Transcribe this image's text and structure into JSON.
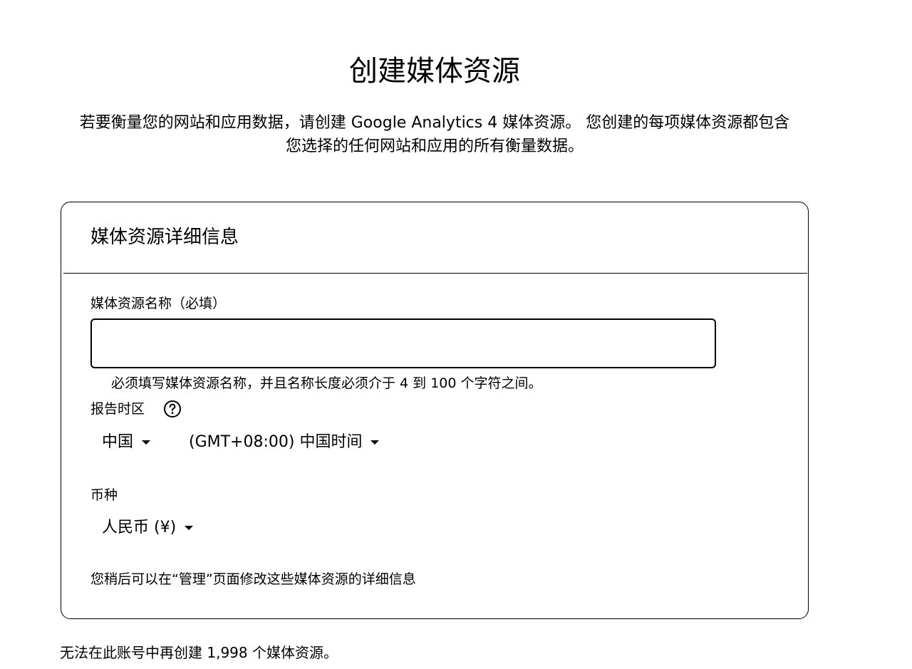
{
  "page": {
    "title": "创建媒体资源",
    "intro_line1": "若要衡量您的网站和应用数据，请创建 Google Analytics 4 媒体资源。 您创建的每项媒体资源都包含",
    "intro_line2": "您选择的任何网站和应用的所有衡量数据。"
  },
  "card": {
    "title": "媒体资源详细信息",
    "property_name": {
      "label": "媒体资源名称（必填）",
      "value": "",
      "placeholder": "",
      "hint": "必须填写媒体资源名称，并且名称长度必须介于 4 到 100 个字符之间。"
    },
    "timezone": {
      "label": "报告时区",
      "help_icon": "help-circle-icon",
      "country_selected": "中国",
      "zone_selected": "(GMT+08:00) 中国时间"
    },
    "currency": {
      "label": "币种",
      "selected": "人民币 (¥)"
    },
    "footnote": "您稍后可以在“管理”页面修改这些媒体资源的详细信息"
  },
  "limit_note": "无法在此账号中再创建 1,998 个媒体资源。"
}
